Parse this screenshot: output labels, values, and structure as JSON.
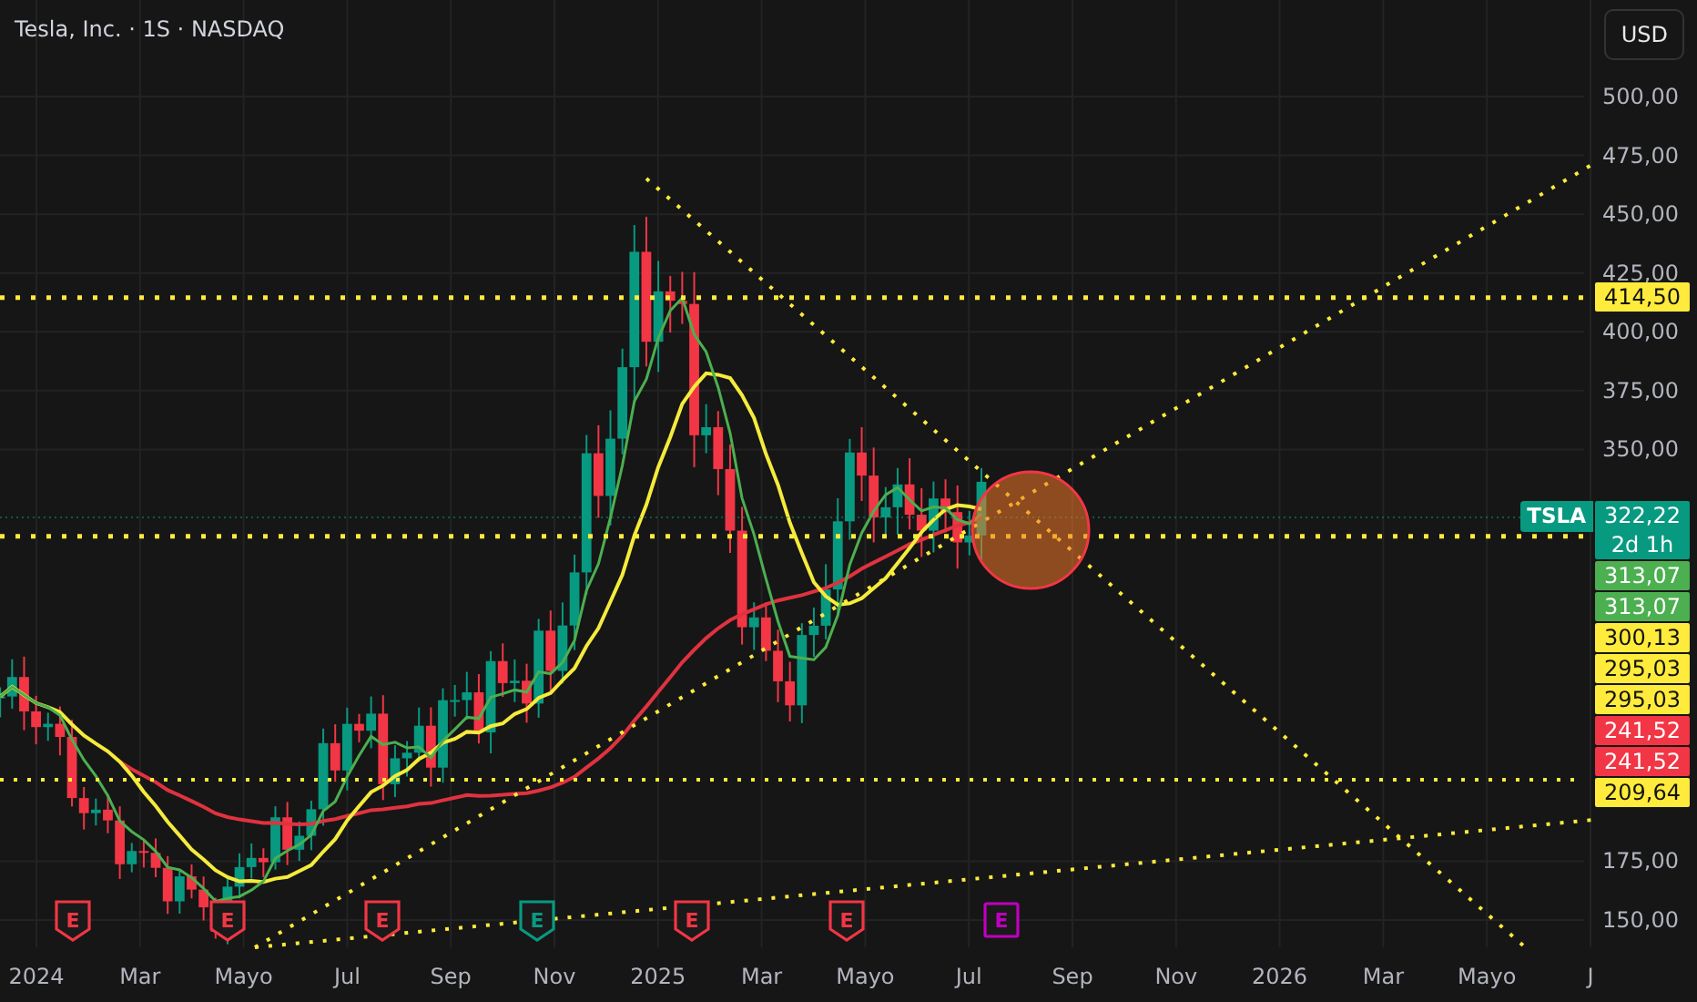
{
  "header": {
    "title": "Tesla, Inc. · 1S · NASDAQ",
    "currency_button": "USD"
  },
  "price_axis": {
    "ticks": [
      "500,00",
      "475,00",
      "450,00",
      "425,00",
      "400,00",
      "375,00",
      "350,00",
      "175,00",
      "150,00"
    ]
  },
  "symbol_badge": {
    "text": "TSLA"
  },
  "price_labels": [
    {
      "text": "414,50",
      "color": "#ffeb3b"
    },
    {
      "text": "322,22",
      "subtext": "2d 1h",
      "color": "#089981"
    },
    {
      "text": "313,07",
      "color": "#4caf50"
    },
    {
      "text": "313,07",
      "color": "#4caf50"
    },
    {
      "text": "300,13",
      "color": "#ffeb3b"
    },
    {
      "text": "295,03",
      "color": "#ffeb3b"
    },
    {
      "text": "295,03",
      "color": "#ffeb3b"
    },
    {
      "text": "241,52",
      "color": "#f23645"
    },
    {
      "text": "241,52",
      "color": "#f23645"
    },
    {
      "text": "209,64",
      "color": "#ffeb3b"
    }
  ],
  "earnings_markers": [
    {
      "label": "E",
      "kind": "past",
      "color": "#f23645"
    },
    {
      "label": "E",
      "kind": "past",
      "color": "#f23645"
    },
    {
      "label": "E",
      "kind": "past",
      "color": "#f23645"
    },
    {
      "label": "E",
      "kind": "past",
      "color": "#089981"
    },
    {
      "label": "E",
      "kind": "past",
      "color": "#f23645"
    },
    {
      "label": "E",
      "kind": "past",
      "color": "#f23645"
    },
    {
      "label": "E",
      "kind": "upcoming",
      "color": "#c000c0"
    }
  ],
  "time_axis": [
    "2024",
    "Mar",
    "Mayo",
    "Jul",
    "Sep",
    "Nov",
    "2025",
    "Mar",
    "Mayo",
    "Jul",
    "Sep",
    "Nov",
    "2026",
    "Mar",
    "Mayo",
    "J"
  ]
}
